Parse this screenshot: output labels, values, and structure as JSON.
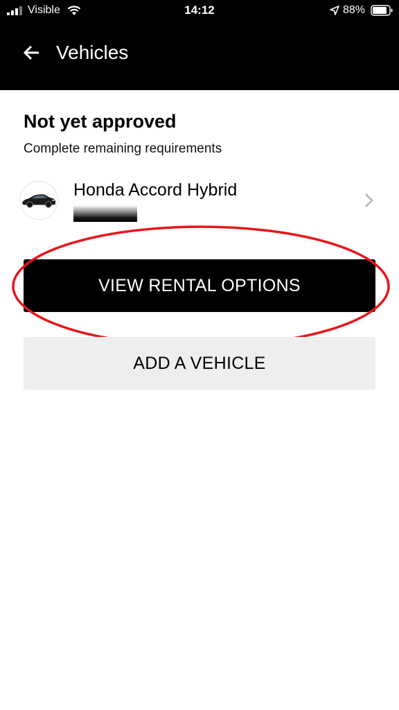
{
  "status_bar": {
    "carrier": "Visible",
    "time": "14:12",
    "battery_percent": "88%",
    "icons": [
      "signal-icon",
      "wifi-icon",
      "location-arrow-icon",
      "battery-icon"
    ]
  },
  "header": {
    "back_icon": "back-arrow-icon",
    "title": "Vehicles"
  },
  "main": {
    "section_title": "Not yet approved",
    "section_subtitle": "Complete remaining requirements",
    "vehicle": {
      "name": "Honda Accord Hybrid",
      "thumbnail_icon": "car-icon",
      "chevron_icon": "chevron-right-icon"
    },
    "primary_button_label": "VIEW RENTAL OPTIONS",
    "secondary_button_label": "ADD A VEHICLE"
  },
  "colors": {
    "header_bg": "#000000",
    "primary_button_bg": "#000000",
    "secondary_button_bg": "#eeeeee",
    "annotation_red": "#e8161b"
  }
}
